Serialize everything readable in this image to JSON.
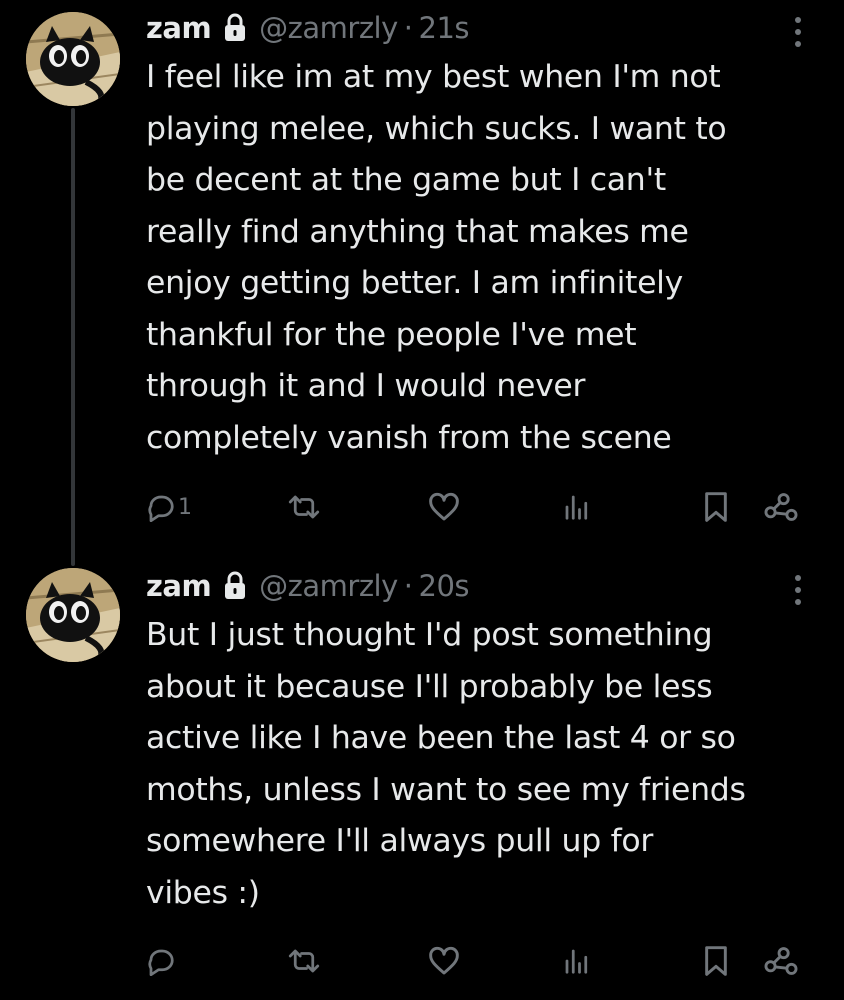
{
  "thread": {
    "tweets": [
      {
        "display_name": "zam",
        "handle": "@zamrzly",
        "separator": "·",
        "time": "21s",
        "text": "I feel like im at my best when I'm not\nplaying melee, which sucks. I want to\nbe decent at the game but I can't\nreally find anything that makes me\nenjoy getting better. I am infinitely\nthankful for the people I've met\nthrough it and I would never\ncompletely vanish from the scene",
        "reply_count": "1",
        "retweet_count": "",
        "like_count": ""
      },
      {
        "display_name": "zam",
        "handle": "@zamrzly",
        "separator": "·",
        "time": "20s",
        "text": "But I just thought I'd post something\nabout it because I'll probably be less\nactive like I have been the last 4 or so\nmoths, unless I want to see my friends\nsomewhere I'll always pull up for\nvibes :)",
        "reply_count": "",
        "retweet_count": "",
        "like_count": ""
      }
    ]
  },
  "icons": {
    "lock": "lock-icon",
    "more": "more-vertical-icon",
    "reply": "reply-icon",
    "retweet": "retweet-icon",
    "like": "heart-icon",
    "views": "views-icon",
    "bookmark": "bookmark-icon",
    "share": "share-icon"
  },
  "colors": {
    "background": "#000000",
    "text_primary": "#e7e9ea",
    "text_secondary": "#71767b",
    "thread_line": "#333639"
  }
}
